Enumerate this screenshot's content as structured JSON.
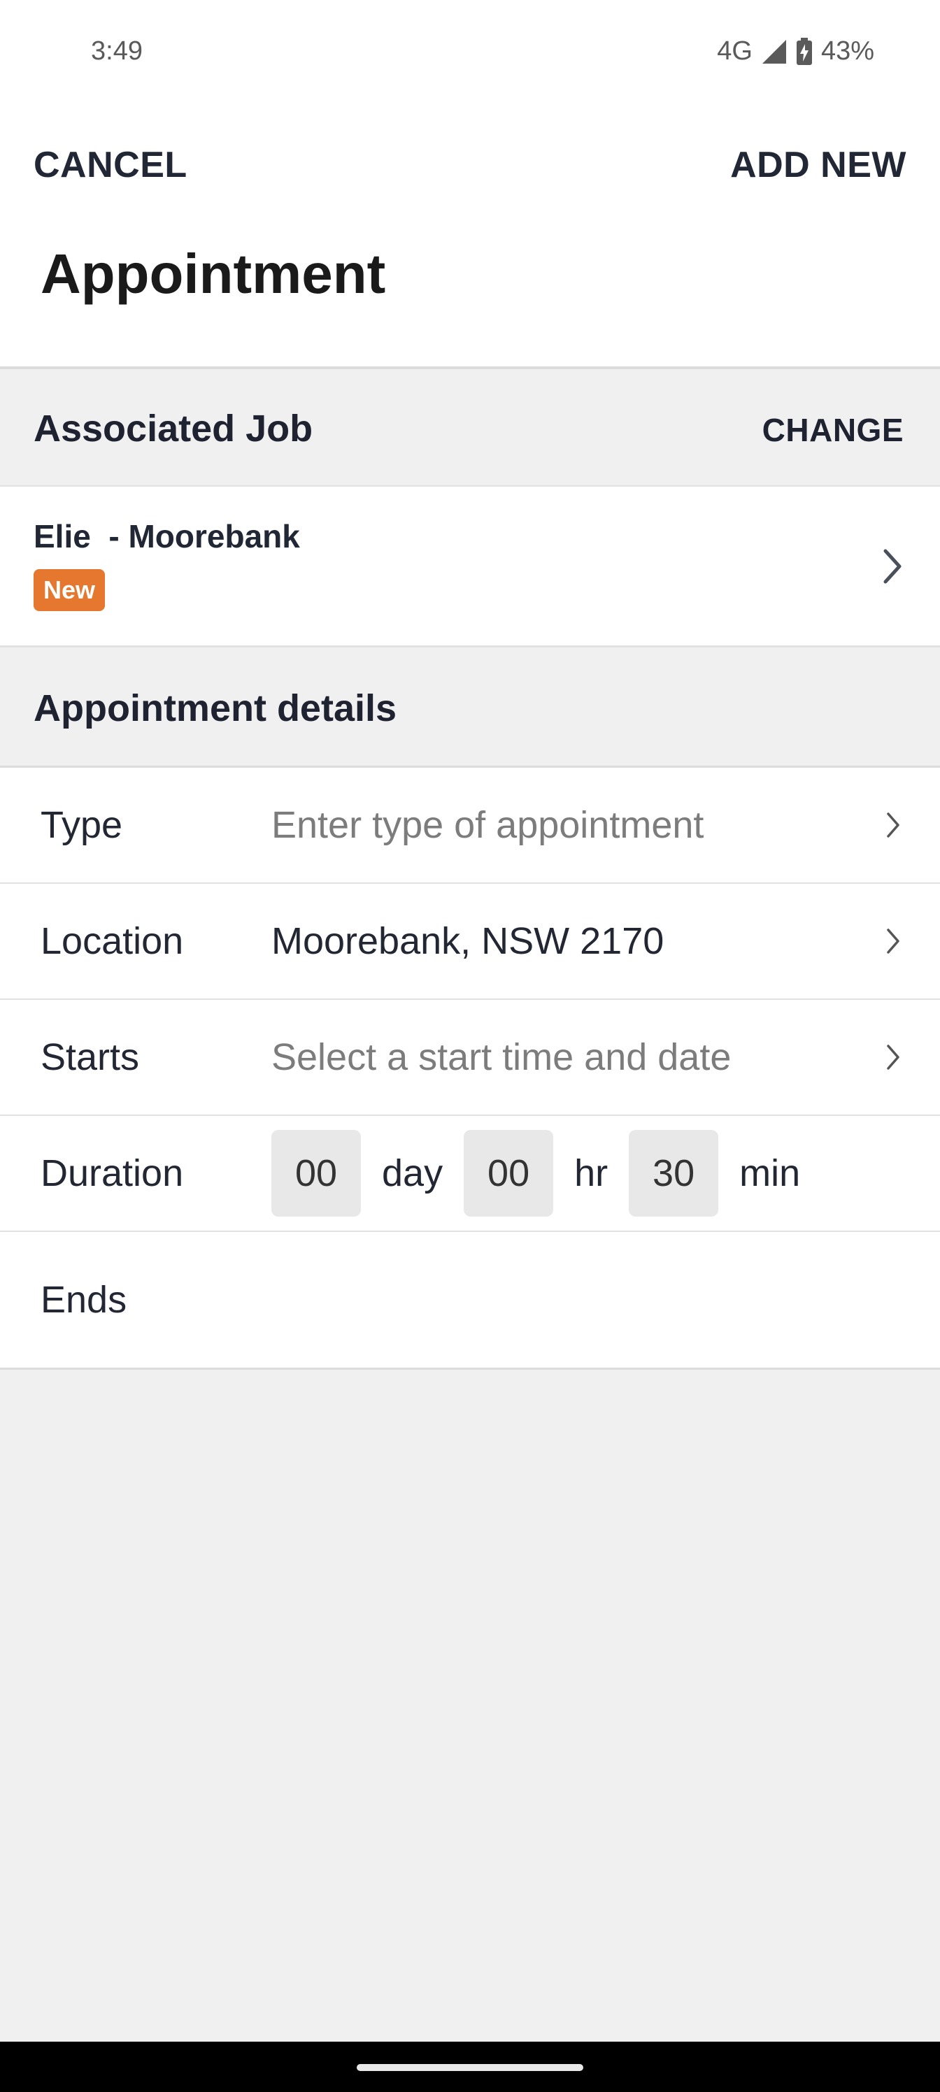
{
  "status": {
    "time": "3:49",
    "network": "4G",
    "battery": "43%"
  },
  "header": {
    "cancel_label": "CANCEL",
    "add_label": "ADD NEW",
    "title": "Appointment"
  },
  "associated_job": {
    "section_title": "Associated Job",
    "change_label": "CHANGE",
    "job_name": "Elie  - Moorebank",
    "badge": "New",
    "badge_color": "#e5772e"
  },
  "details": {
    "section_title": "Appointment details",
    "type": {
      "label": "Type",
      "placeholder": "Enter type of appointment"
    },
    "location": {
      "label": "Location",
      "value": "Moorebank, NSW 2170"
    },
    "starts": {
      "label": "Starts",
      "placeholder": "Select a start time and date"
    },
    "duration": {
      "label": "Duration",
      "days": "00",
      "day_unit": "day",
      "hours": "00",
      "hour_unit": "hr",
      "minutes": "30",
      "minute_unit": "min"
    },
    "ends": {
      "label": "Ends"
    }
  }
}
